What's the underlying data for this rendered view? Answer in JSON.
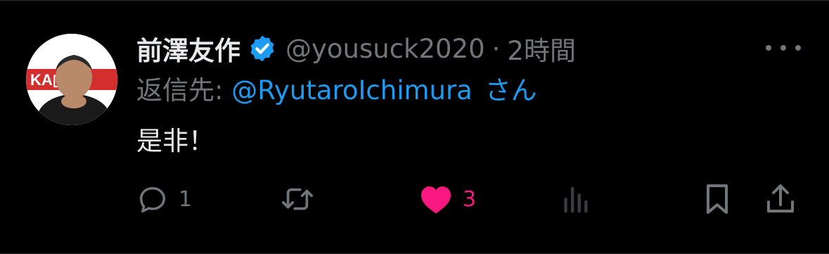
{
  "tweet": {
    "author_name": "前澤友作",
    "handle": "@yousuck2020",
    "separator": "·",
    "time": "2時間",
    "reply_prefix": "返信先:",
    "reply_user": "@RyutaroIchimura",
    "reply_suffix": "さん",
    "text": "是非！",
    "avatar_text": "KA▯I&"
  },
  "actions": {
    "reply_count": "1",
    "retweet_count": "",
    "like_count": "3",
    "liked": true
  },
  "colors": {
    "background": "#000000",
    "text": "#e7e9ea",
    "muted": "#71767b",
    "link": "#1d9bf0",
    "like": "#f91880",
    "verified": "#1d9bf0"
  },
  "icons": {
    "verified": "verified-badge-icon",
    "more": "more-dots-icon",
    "reply": "reply-icon",
    "retweet": "retweet-icon",
    "like": "heart-filled-icon",
    "views": "analytics-icon",
    "bookmark": "bookmark-icon",
    "share": "share-icon"
  }
}
